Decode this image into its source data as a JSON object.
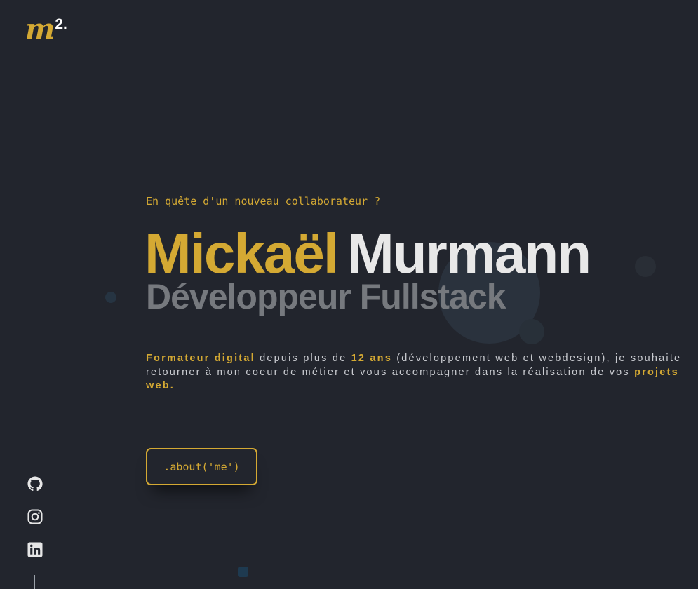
{
  "logo": {
    "letter": "m",
    "superscript": "2."
  },
  "hero": {
    "eyebrow": "En quête d'un nouveau collaborateur ?",
    "first_name": "Mickaël",
    "last_name": "Murmann",
    "role": "Développeur Fullstack"
  },
  "intro": {
    "highlight_1": "Formateur digital",
    "text_1": " depuis plus de ",
    "highlight_2": "12 ans",
    "text_2": " (développement web et webdesign), je souhaite retourner à mon coeur de métier et vous accompagner dans la réalisation de vos ",
    "highlight_3": "projets web."
  },
  "cta": {
    "label": ".about('me')"
  },
  "social": [
    {
      "icon": "github-icon"
    },
    {
      "icon": "instagram-icon"
    },
    {
      "icon": "linkedin-icon"
    }
  ],
  "colors": {
    "background": "#22252d",
    "accent": "#d4a933",
    "name_light": "#e8e8e8",
    "role_gray": "#76797e"
  }
}
